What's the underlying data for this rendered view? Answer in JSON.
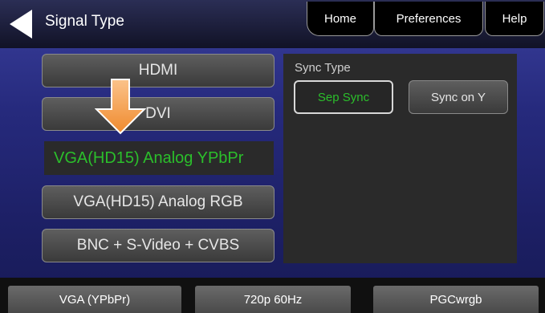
{
  "header": {
    "title": "Signal Type",
    "tabs": [
      {
        "label": "Home"
      },
      {
        "label": "Preferences"
      },
      {
        "label": "Help"
      }
    ]
  },
  "signal_buttons": [
    {
      "label": "HDMI",
      "selected": false
    },
    {
      "label": "DVI",
      "selected": false
    },
    {
      "label": "VGA(HD15) Analog YPbPr",
      "selected": true
    },
    {
      "label": "VGA(HD15) Analog RGB",
      "selected": false
    },
    {
      "label": "BNC + S-Video + CVBS",
      "selected": false
    }
  ],
  "sync": {
    "label": "Sync Type",
    "options": [
      {
        "label": "Sep Sync",
        "selected": true
      },
      {
        "label": "Sync on Y",
        "selected": false
      }
    ]
  },
  "status_bar": [
    "VGA (YPbPr)",
    "720p 60Hz",
    "PGCwrgb"
  ],
  "colors": {
    "selected_text": "#2bbf2b",
    "annotation_arrow": "#f5a04a",
    "background": "#262a7d"
  }
}
